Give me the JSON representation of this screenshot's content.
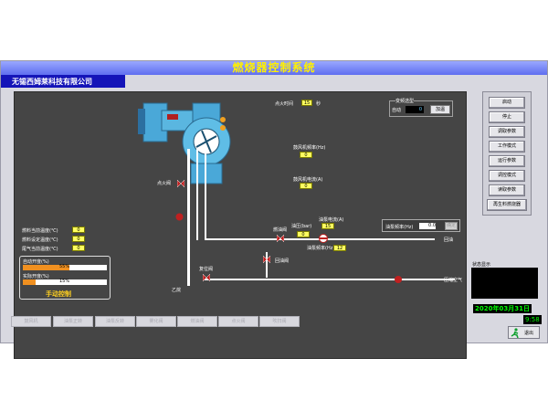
{
  "header": {
    "title": "燃烧器控制系统",
    "company": "无锡西姆莱科技有限公司"
  },
  "process": {
    "ignition_time_label": "点火时间",
    "ignition_time_value": "15",
    "ignition_time_unit": "秒",
    "fan_freq_label": "鼓风机频率(Hz)",
    "fan_freq_value": "0",
    "fan_current_label": "鼓风机电流(A)",
    "fan_current_value": "0",
    "mixing_group_label": "变频选型",
    "mixing_mode": "自动",
    "mixing_value": "0",
    "add_button": "加温",
    "pump_freq_label": "油泵频率(Hz)",
    "pump_freq_value": "0.0",
    "pump_freq_confirm": "确定",
    "oil_pressure_label": "油压(bar)",
    "oil_pressure_value": "15",
    "pump_current_label": "油泵电流(A)",
    "pump_current_value": "0",
    "pump_freq2_label": "油泵频率(Hz)",
    "pump_freq2_value": "12",
    "fuel_temp_label": "燃料当前温度(℃)",
    "fuel_temp_value": "0",
    "fuel_setpoint_label": "燃料设定温度(℃)",
    "fuel_setpoint_value": "0",
    "exhaust_temp_label": "尾气当前温度(℃)",
    "exhaust_temp_value": "0",
    "ignition_valve_label": "点火阀",
    "bypass_valve_label": "燃油阀",
    "return_valve_label": "回油阀",
    "main_valve_label": "复位阀",
    "drain_label": "乙烷",
    "return_oil_label": "回油",
    "compressed_air_label": "压缩空气",
    "control_valve_label": "自动开度(%)",
    "control_valve_value": "55%",
    "control_valve_level": 0.55,
    "actual_valve_label": "实际开度(%)",
    "actual_valve_value": "15%",
    "actual_valve_level": 0.15,
    "mode_label": "手动控制"
  },
  "side_buttons": [
    "启动",
    "停止",
    "调取参数",
    "工作模式",
    "运行参数",
    "调控模式",
    "读取参数",
    "再生料燃烧器"
  ],
  "status": {
    "label": "状态显示",
    "date": "2020年03月31日",
    "time": "9:58",
    "exit_label": "退出"
  },
  "bottom_buttons": [
    "鼓风机",
    "油泵正转",
    "油泵反转",
    "雾化阀",
    "燃油阀",
    "点火阀",
    "吹扫阀"
  ],
  "colors": {
    "panel": "#454545",
    "value_box": "#ffff60",
    "title": "#5f6ef0",
    "company": "#1414b8",
    "date": "#00ff00"
  }
}
